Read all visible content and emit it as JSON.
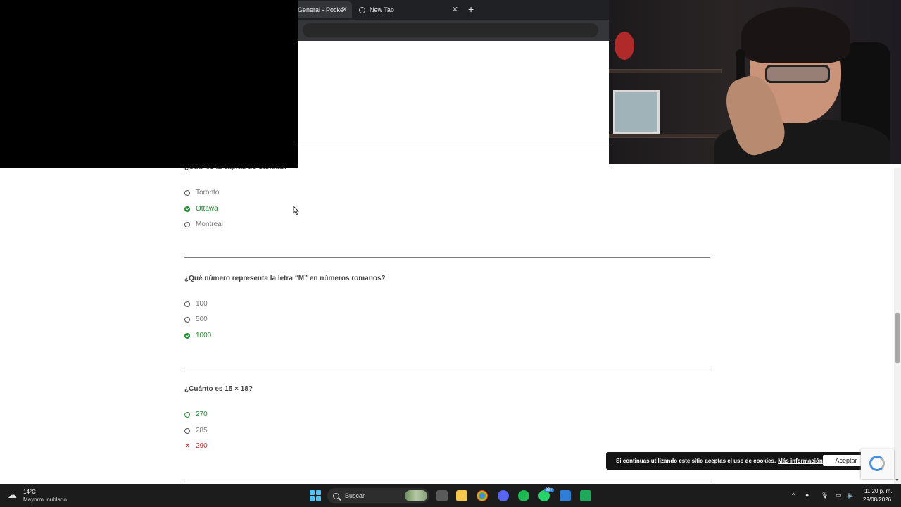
{
  "browser": {
    "tabs": [
      {
        "label": "General - Pocke"
      },
      {
        "label": "New Tab"
      }
    ]
  },
  "quiz": [
    {
      "question": "¿Cuál es la capital de Canadá?",
      "options": [
        {
          "label": "Toronto",
          "state": "neutral"
        },
        {
          "label": "Ottawa",
          "state": "correct"
        },
        {
          "label": "Montreal",
          "state": "neutral"
        }
      ]
    },
    {
      "question": "¿Qué número representa la letra “M” en números romanos?",
      "options": [
        {
          "label": "100",
          "state": "neutral"
        },
        {
          "label": "500",
          "state": "neutral"
        },
        {
          "label": "1000",
          "state": "correct"
        }
      ]
    },
    {
      "question": "¿Cuánto es 15 × 18?",
      "options": [
        {
          "label": "270",
          "state": "chosen"
        },
        {
          "label": "285",
          "state": "neutral"
        },
        {
          "label": "290",
          "state": "wrong"
        }
      ]
    }
  ],
  "cookie": {
    "text": "Si continuas utilizando este sitio aceptas el uso de cookies.",
    "link": "Más información",
    "accept": "Aceptar"
  },
  "taskbar": {
    "weather_temp": "14°C",
    "weather_desc": "Mayorm. nublado",
    "search_label": "Buscar",
    "whatsapp_badge": "99+",
    "time": "11:20 p. m.",
    "date": "29/08/2026"
  },
  "colors": {
    "correct": "#1e8d2c",
    "wrong": "#c62828",
    "taskbar": "#1c1c1c"
  }
}
